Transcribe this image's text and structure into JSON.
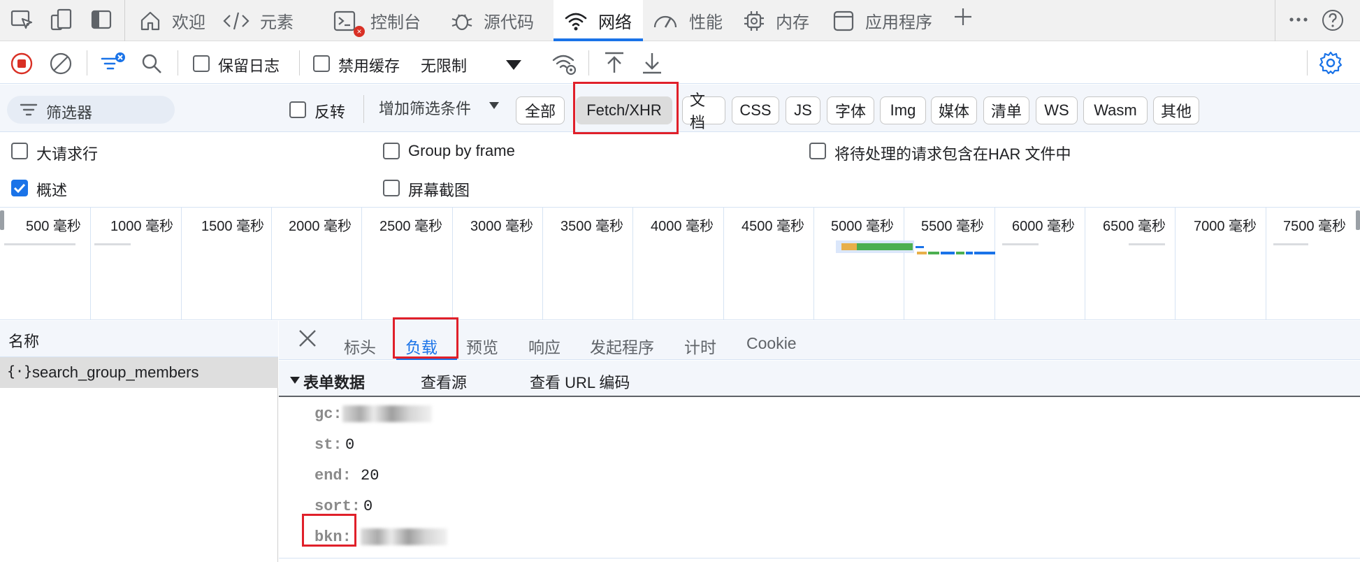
{
  "tabs": [
    {
      "label": "欢迎",
      "icon": "home-icon"
    },
    {
      "label": "元素",
      "icon": "code-icon"
    },
    {
      "label": "控制台",
      "icon": "console-icon"
    },
    {
      "label": "源代码",
      "icon": "bug-icon"
    },
    {
      "label": "网络",
      "icon": "wifi-icon",
      "active": true
    },
    {
      "label": "性能",
      "icon": "gauge-icon"
    },
    {
      "label": "内存",
      "icon": "chip-icon"
    },
    {
      "label": "应用程序",
      "icon": "window-icon"
    }
  ],
  "toolbar": {
    "preserve_log": "保留日志",
    "disable_cache": "禁用缓存",
    "throttle": "无限制"
  },
  "filter": {
    "placeholder": "筛选器",
    "invert": "反转",
    "more_filters": "增加筛选条件",
    "types": [
      "全部",
      "Fetch/XHR",
      "文档",
      "CSS",
      "JS",
      "字体",
      "Img",
      "媒体",
      "清单",
      "WS",
      "Wasm",
      "其他"
    ],
    "selected": "Fetch/XHR"
  },
  "options": {
    "large_rows": "大请求行",
    "group_by_frame": "Group by frame",
    "har_pending": "将待处理的请求包含在HAR 文件中",
    "overview": "概述",
    "screenshots": "屏幕截图",
    "overview_checked": true
  },
  "timeline": {
    "ticks": [
      "500 毫秒",
      "1000 毫秒",
      "1500 毫秒",
      "2000 毫秒",
      "2500 毫秒",
      "3000 毫秒",
      "3500 毫秒",
      "4000 毫秒",
      "4500 毫秒",
      "5000 毫秒",
      "5500 毫秒",
      "6000 毫秒",
      "6500 毫秒",
      "7000 毫秒",
      "7500 毫秒"
    ]
  },
  "requests": {
    "header": "名称",
    "items": [
      "search_group_members"
    ]
  },
  "detail_tabs": [
    "标头",
    "负载",
    "预览",
    "响应",
    "发起程序",
    "计时",
    "Cookie"
  ],
  "active_detail_tab": "负载",
  "payload": {
    "section_title": "表单数据",
    "view_source": "查看源",
    "view_url_encoded": "查看 URL 编码",
    "fields": [
      {
        "key": "gc:",
        "value": ""
      },
      {
        "key": "st:",
        "value": "0"
      },
      {
        "key": "end:",
        "value": "20"
      },
      {
        "key": "sort:",
        "value": "0"
      },
      {
        "key": "bkn:",
        "value": ""
      }
    ]
  },
  "colors": {
    "accent": "#1a73e8",
    "highlight": "#e0202a"
  }
}
